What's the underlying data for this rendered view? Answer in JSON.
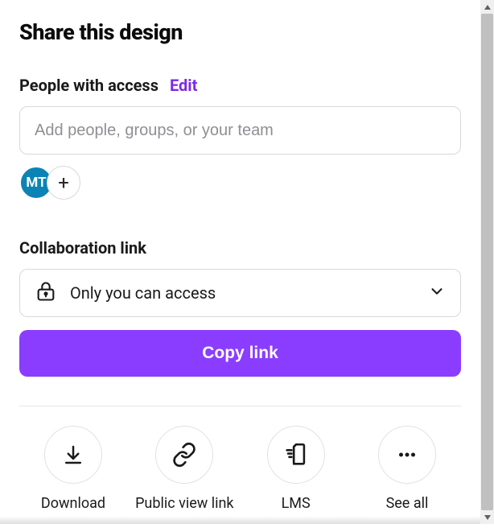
{
  "title": "Share this design",
  "peopleAccess": {
    "label": "People with access",
    "editLabel": "Edit",
    "inputPlaceholder": "Add people, groups, or your team"
  },
  "avatars": {
    "primary": "MT",
    "addSymbol": "+"
  },
  "collabLink": {
    "label": "Collaboration link",
    "selected": "Only you can access"
  },
  "copyButton": "Copy link",
  "actions": {
    "download": "Download",
    "publicView": "Public view link",
    "lms": "LMS",
    "seeAll": "See all"
  }
}
